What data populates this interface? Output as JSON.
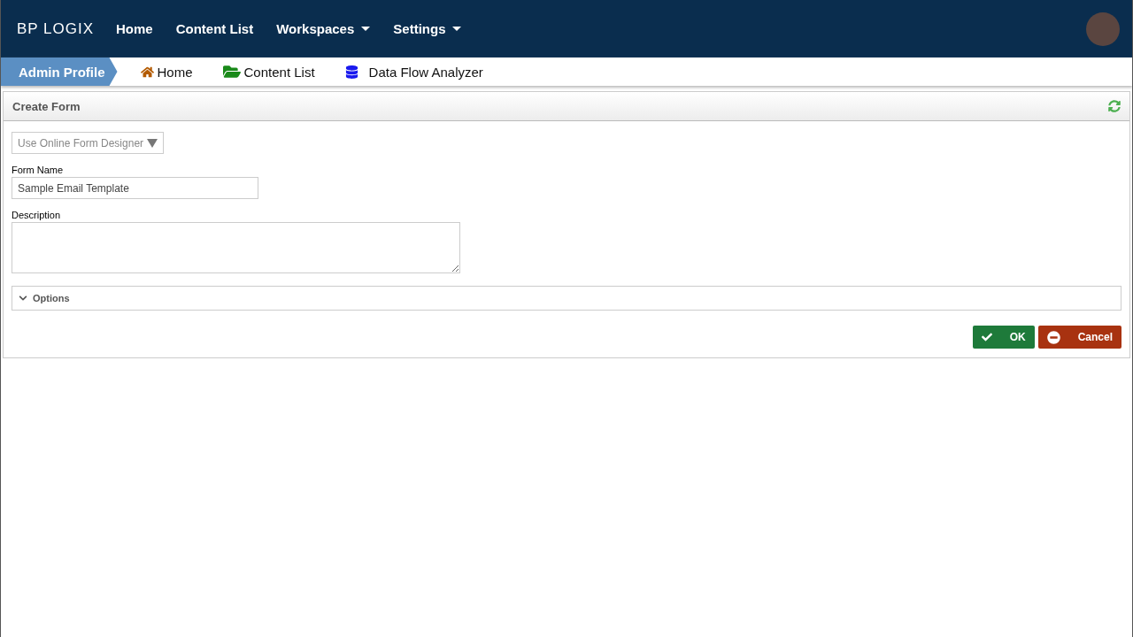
{
  "header": {
    "logo": "BP LOGIX",
    "nav": [
      {
        "label": "Home",
        "dropdown": false
      },
      {
        "label": "Content List",
        "dropdown": false
      },
      {
        "label": "Workspaces",
        "dropdown": true
      },
      {
        "label": "Settings",
        "dropdown": true
      }
    ]
  },
  "breadcrumbs": [
    {
      "label": "Admin Profile",
      "kind": "profile",
      "selected": true
    },
    {
      "label": "Home",
      "kind": "home",
      "selected": false
    },
    {
      "label": "Content List",
      "kind": "folder",
      "selected": false
    },
    {
      "label": "Data Flow Analyzer",
      "kind": "database",
      "selected": false
    }
  ],
  "panel": {
    "title": "Create Form",
    "designer_select": "Use Online Form Designer",
    "fields": [
      {
        "label": "Form Name",
        "kind": "text",
        "value": "Sample Email Template"
      },
      {
        "label": "Description",
        "kind": "textarea"
      }
    ],
    "options": {
      "label": "Options",
      "expanded": false
    },
    "buttons": [
      {
        "label": "OK",
        "kind": "ok"
      },
      {
        "label": "Cancel",
        "kind": "cancel"
      }
    ]
  }
}
